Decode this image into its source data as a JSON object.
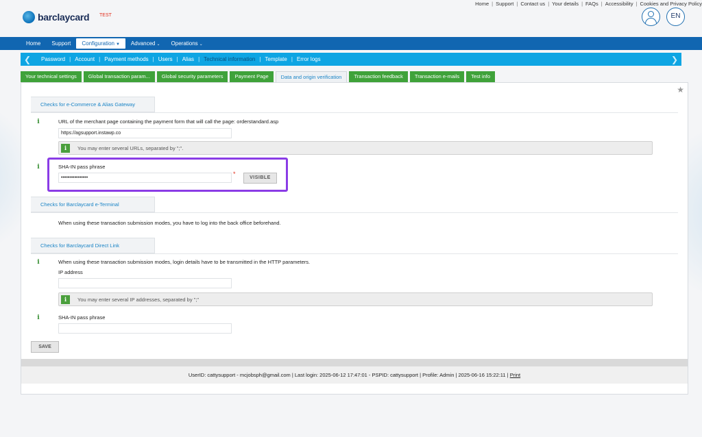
{
  "top_links": [
    "Home",
    "Support",
    "Contact us",
    "Your details",
    "FAQs",
    "Accessibility",
    "Cookies and Privacy Policy"
  ],
  "brand": {
    "name": "barclaycard",
    "env_label": "TEST"
  },
  "lang": "EN",
  "main_nav": [
    {
      "label": "Home"
    },
    {
      "label": "Support"
    },
    {
      "label": "Configuration"
    },
    {
      "label": "Advanced"
    },
    {
      "label": "Operations"
    }
  ],
  "sub_nav": [
    "Password",
    "Account",
    "Payment methods",
    "Users",
    "Alias",
    "Technical information",
    "Template",
    "Error logs"
  ],
  "tabs": [
    "Your technical settings",
    "Global transaction param...",
    "Global security parameters",
    "Payment Page",
    "Data and origin verification",
    "Transaction feedback",
    "Transaction e-mails",
    "Test info"
  ],
  "section1": {
    "title": "Checks for e-Commerce & Alias Gateway",
    "url_label": "URL of the merchant page containing the payment form that will call the page: orderstandard.asp",
    "url_value": "https://agsupport.instawp.co",
    "url_hint": "You may enter several URLs, separated by \";\".",
    "sha_label": "SHA-IN pass phrase",
    "sha_value": "••••••••••••••••",
    "required_mark": "*",
    "visible_button": "VISIBLE"
  },
  "section2": {
    "title": "Checks for Barclaycard e-Terminal",
    "text": "When using these transaction submission modes, you have to log into the back office beforehand."
  },
  "section3": {
    "title": "Checks for Barclaycard Direct Link",
    "text": "When using these transaction submission modes, login details have to be transmitted in the HTTP parameters.",
    "ip_label": "IP address",
    "ip_hint": "You may enter several IP addresses, separated by \";\"",
    "sha_label": "SHA-IN pass phrase"
  },
  "save_button": "SAVE",
  "footer": {
    "text": "UserID: cattysupport - mcjobsph@gmail.com | Last login: 2025-06-12 17:47:01 - PSPID: cattysupport | Profile: Admin | 2025-06-16 15:22:11 | ",
    "print": "Print"
  }
}
